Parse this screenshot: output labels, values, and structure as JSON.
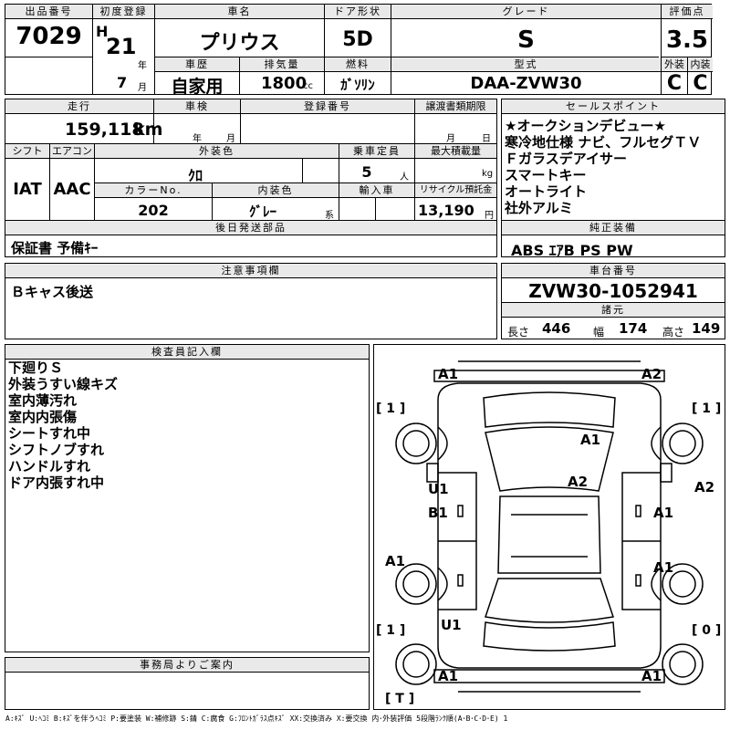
{
  "header": {
    "lot_label": "出品番号",
    "lot_no": "7029",
    "first_reg_label": "初度登録",
    "era": "H",
    "year": "21",
    "year_unit": "年",
    "month": "7",
    "month_unit": "月",
    "car_name_label": "車名",
    "car_name": "プリウス",
    "door_label": "ドア形状",
    "door": "5D",
    "grade_label": "グレード",
    "grade": "S",
    "score_label": "評価点",
    "score": "3.5",
    "history_label": "車歴",
    "history": "自家用",
    "displacement_label": "排気量",
    "displacement": "1800",
    "displacement_unit": "cc",
    "fuel_label": "燃料",
    "fuel": "ｶﾞｿﾘﾝ",
    "model_label": "型式",
    "model": "DAA-ZVW30",
    "exterior_label": "外装",
    "exterior_grade": "C",
    "interior_label": "内装",
    "interior_grade": "C"
  },
  "row2": {
    "mileage_label": "走行",
    "mileage": "159,118",
    "mileage_unit": "km",
    "inspection_label": "車検",
    "insp_year_unit": "年",
    "insp_month_unit": "月",
    "regno_label": "登録番号",
    "transfer_label": "譲渡書類期限",
    "transfer_month_unit": "月",
    "transfer_day_unit": "日",
    "shift_label": "シフト",
    "shift": "IAT",
    "ac_label": "エアコン",
    "ac": "AAC",
    "color_label": "外装色",
    "color": "ｸﾛ",
    "capacity_label": "乗車定員",
    "capacity": "5",
    "capacity_unit": "人",
    "load_label": "最大積載量",
    "load_unit": "kg",
    "color_no_label": "カラーNo.",
    "color_no": "202",
    "int_color_label": "内装色",
    "int_color": "ｸﾞﾚｰ",
    "int_color_suffix": "系",
    "import_label": "輸入車",
    "recycle_label": "リサイクル預託金",
    "recycle": "13,190",
    "recycle_unit": "円",
    "later_label": "後日発送部品",
    "later": "保証書 予備ｷｰ"
  },
  "sales_points": {
    "label": "セールスポイント",
    "lines": [
      "★オークションデビュー★",
      "寒冷地仕様 ナビ、フルセグＴＶ",
      "Ｆガラスデアイサー",
      "スマートキー",
      "オートライト",
      "社外アルミ"
    ]
  },
  "equipment": {
    "label": "純正装備",
    "value": "ABS ｴｱB PS PW"
  },
  "notes": {
    "label": "注意事項欄",
    "value": "Ｂキャス後送"
  },
  "chassis": {
    "label": "車台番号",
    "value": "ZVW30-1052941",
    "spec_label": "諸元",
    "length_label": "長さ",
    "length": "446",
    "width_label": "幅",
    "width": "174",
    "height_label": "高さ",
    "height": "149"
  },
  "inspector": {
    "label": "検査員記入欄",
    "lines": [
      "下廻りＳ",
      "外装うすい線キズ",
      "室内薄汚れ",
      "室内内張傷",
      "シートすれ中",
      "シフトノブすれ",
      "ハンドルすれ",
      "ドア内張すれ中"
    ]
  },
  "office": {
    "label": "事務局よりご案内"
  },
  "diagram": {
    "marks": {
      "front_left": "A1",
      "front_right": "A2",
      "hood": "A1",
      "windshield": "A2",
      "left_door_u": "U1",
      "left_door_b": "B1",
      "right_front_door": "A1",
      "right_fender": "A2",
      "left_rear_quarter": "A1",
      "right_rear_door": "A1",
      "rear_u": "U1",
      "rear_left": "A1",
      "rear_right": "A1"
    },
    "wheels": {
      "front_left": "[ 1 ]",
      "front_right": "[ 1 ]",
      "rear_left": "[ 1 ]",
      "rear_right": "[ 0 ]",
      "spare": "[ T ]"
    }
  },
  "legend": "A:ｷｽﾞ U:ﾍｺﾐ B:ｷｽﾞを伴うﾍｺﾐ P:要塗装 W:補修跡 S:錆 C:腐食 G:ﾌﾛﾝﾄｶﾞﾗｽ点ｷｽﾞ XX:交換済み X:要交換 内･外装評価 5段階ﾗﾝｸ順(A･B･C･D･E) 1"
}
